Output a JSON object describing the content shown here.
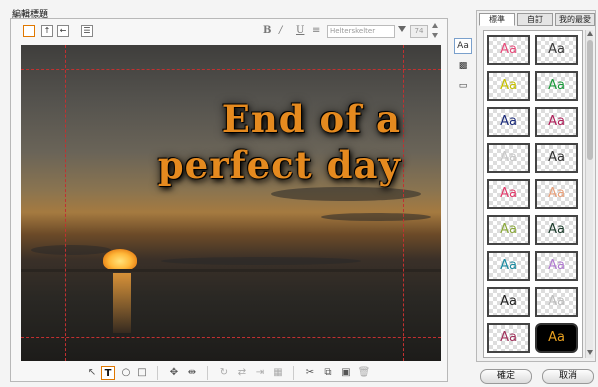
{
  "section_title": "編輯標題",
  "top_toolbar": {
    "bold": "B",
    "italic": "/",
    "underline": "U",
    "align": "≡",
    "font_name": "Helterskelter",
    "font_size": "74"
  },
  "canvas": {
    "title_line1": "End of a",
    "title_line2": "perfect day"
  },
  "style_panel": {
    "tabs": [
      "標準",
      "自訂",
      "我的最愛"
    ],
    "tiles": [
      {
        "label": "Aa",
        "color": "#e84a7a"
      },
      {
        "label": "Aa",
        "color": "#3a3a3a"
      },
      {
        "label": "Aa",
        "color": "#c6c000"
      },
      {
        "label": "Aa",
        "color": "#1a9a3a"
      },
      {
        "label": "Aa",
        "color": "#1a2a7a"
      },
      {
        "label": "Aa",
        "color": "#b0205a"
      },
      {
        "label": "Aa",
        "color": "#c8c8c8"
      },
      {
        "label": "Aa",
        "color": "#333333"
      },
      {
        "label": "Aa",
        "color": "#e23a6a"
      },
      {
        "label": "Aa",
        "color": "#e8a07a"
      },
      {
        "label": "Aa",
        "color": "#8aa83a"
      },
      {
        "label": "Aa",
        "color": "#1a3a2a"
      },
      {
        "label": "Aa",
        "color": "#1a8aa0"
      },
      {
        "label": "Aa",
        "color": "#b07ad0"
      },
      {
        "label": "Aa",
        "color": "#222222"
      },
      {
        "label": "Aa",
        "color": "#bdbdbd"
      },
      {
        "label": "Aa",
        "color": "#a0305a"
      },
      {
        "label": "Aa",
        "color": "#e8a020"
      }
    ]
  },
  "buttons": {
    "ok": "確定",
    "cancel": "取消"
  }
}
